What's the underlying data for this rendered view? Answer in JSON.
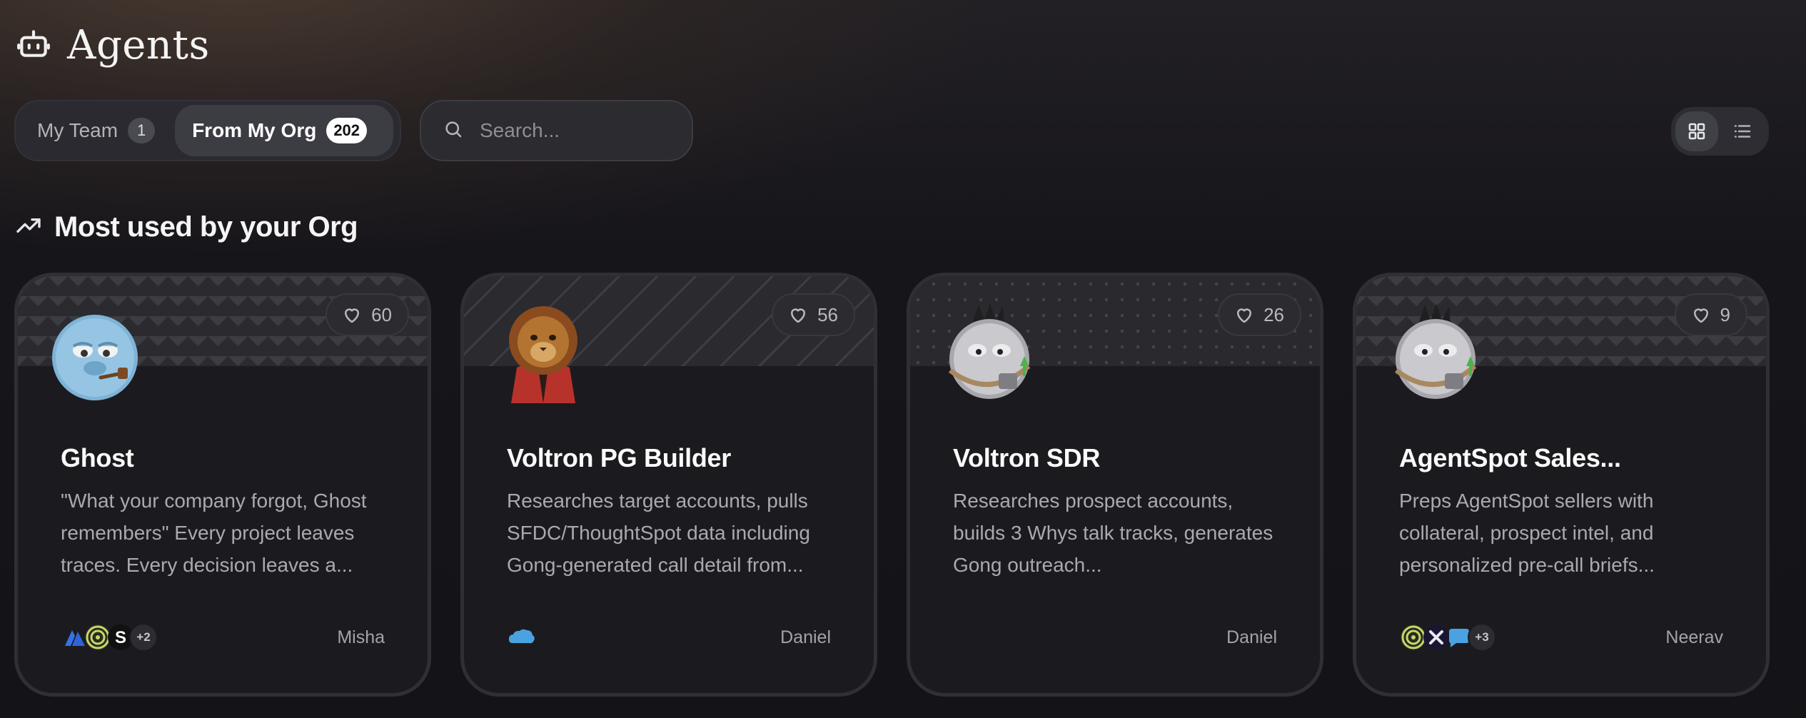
{
  "header": {
    "title": "Agents",
    "icon": "robot-icon"
  },
  "tabs": [
    {
      "label": "My Team",
      "count": "1"
    },
    {
      "label": "From My Org",
      "count": "202"
    }
  ],
  "search": {
    "placeholder": "Search...",
    "icon": "search-icon"
  },
  "view_toggle": {
    "options": [
      "grid-view-icon",
      "list-view-icon"
    ],
    "selected": "grid-view-icon"
  },
  "section": {
    "title": "Most used by your Org",
    "icon": "trending-up-icon"
  },
  "colors": {
    "accent_white": "#ffffff",
    "card_bg": "#1b1b1f",
    "muted_text": "#a9a9b0"
  },
  "cards": [
    {
      "title": "Ghost",
      "description": "\"What your company forgot, Ghost remembers\" Every project leaves traces. Every decision leaves a...",
      "likes": "60",
      "owner": "Misha",
      "avatar": "blue-furry-creature-with-pipe",
      "tools": [
        "atlassian-logo",
        "spiral-logo",
        "s-logo"
      ],
      "more": "+2"
    },
    {
      "title": "Voltron PG Builder",
      "description": "Researches target accounts, pulls SFDC/ThoughtSpot data including Gong-generated call detail from...",
      "likes": "56",
      "owner": "Daniel",
      "avatar": "lion-in-red-jacket",
      "tools": [
        "salesforce-cloud-logo"
      ],
      "more": ""
    },
    {
      "title": "Voltron SDR",
      "description": "Researches prospect accounts, builds 3 Whys talk tracks, generates Gong outreach...",
      "likes": "26",
      "owner": "Daniel",
      "avatar": "grey-furry-creature-with-satchel",
      "tools": [],
      "more": ""
    },
    {
      "title": "AgentSpot Sales...",
      "description": "Preps AgentSpot sellers with collateral, prospect intel, and personalized pre-call briefs...",
      "likes": "9",
      "owner": "Neerav",
      "avatar": "grey-furry-creature-with-satchel",
      "tools": [
        "spiral-logo",
        "x-logo",
        "chat-bubble-logo"
      ],
      "more": "+3"
    }
  ]
}
